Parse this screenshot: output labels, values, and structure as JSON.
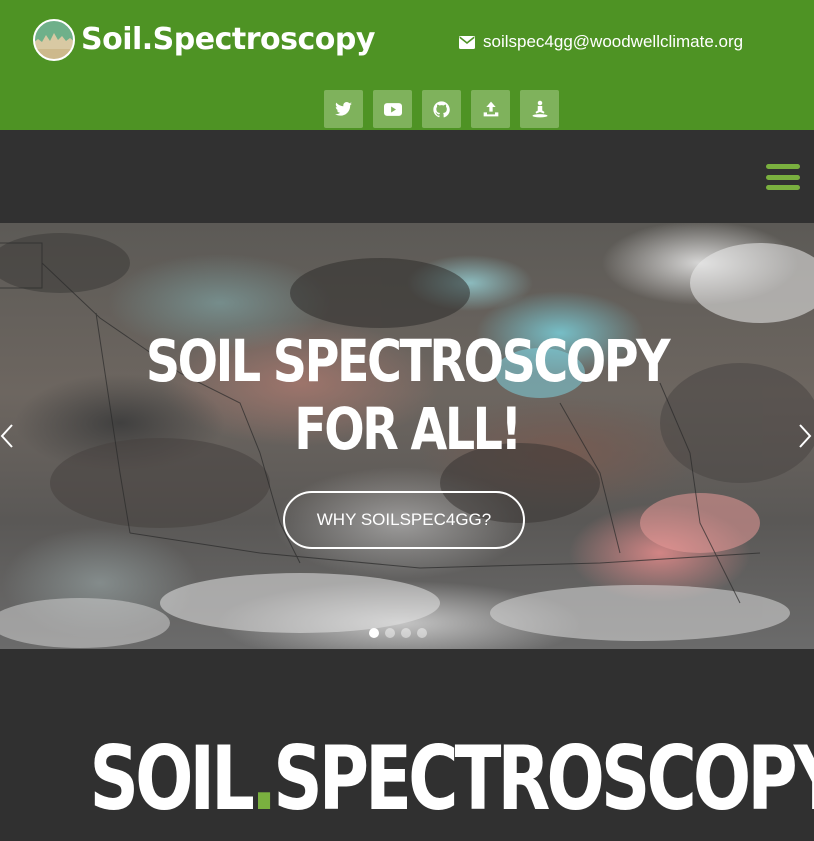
{
  "header": {
    "logo_text": "Soil.Spectroscopy",
    "email": "soilspec4gg@woodwellclimate.org",
    "colors": {
      "header_bg": "#4e9324",
      "social_btn_bg": "#7fb25c",
      "accent": "#7ab03f",
      "dark_bg": "#303030"
    },
    "social_icons": [
      "twitter-icon",
      "youtube-icon",
      "github-icon",
      "upload-icon",
      "yoga-icon"
    ]
  },
  "nav": {
    "menu_icon": "hamburger-menu-icon"
  },
  "hero": {
    "title": "SOIL SPECTROSCOPY FOR ALL!",
    "cta_label": "WHY SOILSPEC4GG?",
    "slide_count": 4,
    "active_slide": 1
  },
  "section": {
    "heading_part1": "SOIL",
    "heading_dot": ".",
    "heading_part2": "SPECTROSCOPY"
  }
}
